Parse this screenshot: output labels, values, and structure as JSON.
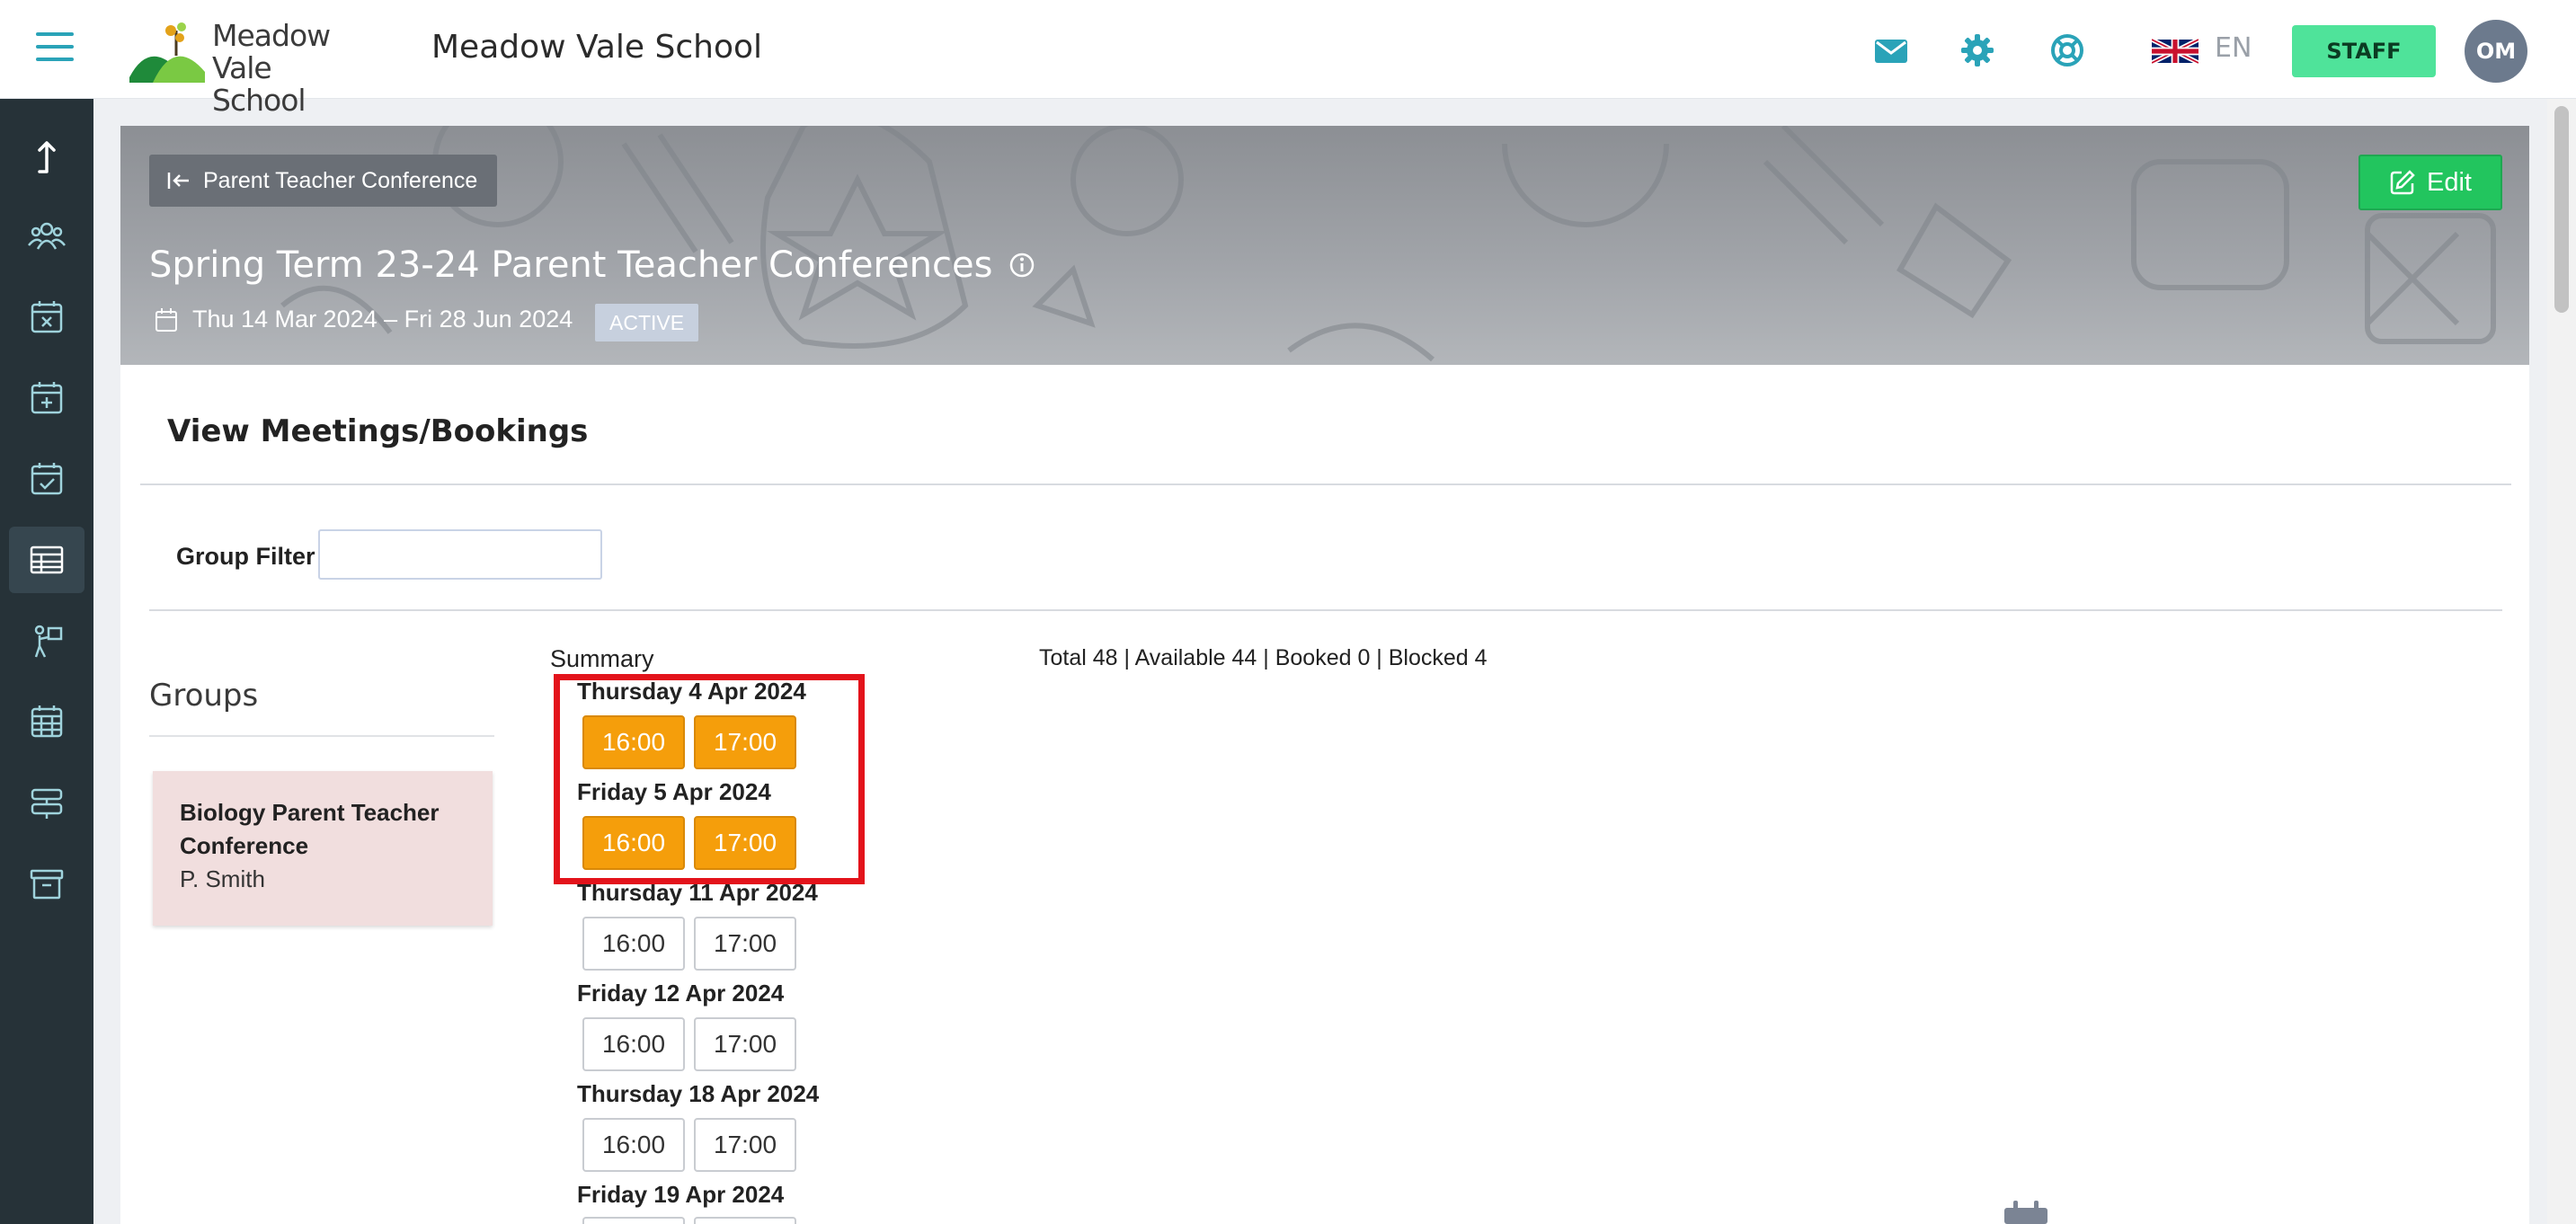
{
  "header": {
    "logo_line1": "Meadow",
    "logo_line2": "Vale School",
    "school_name": "Meadow Vale School",
    "language": "EN",
    "role_button": "STAFF",
    "avatar_initials": "OM"
  },
  "sidebar": {
    "items": [
      {
        "icon": "upload-icon"
      },
      {
        "icon": "users-icon"
      },
      {
        "icon": "calendar-x-icon"
      },
      {
        "icon": "calendar-plus-icon"
      },
      {
        "icon": "calendar-check-icon"
      },
      {
        "icon": "table-icon",
        "active": true
      },
      {
        "icon": "person-board-icon"
      },
      {
        "icon": "calendar-grid-icon"
      },
      {
        "icon": "signpost-icon"
      },
      {
        "icon": "archive-icon"
      }
    ]
  },
  "hero": {
    "back_label": "Parent Teacher Conference",
    "edit_label": "Edit",
    "title": "Spring Term 23-24 Parent Teacher Conferences",
    "date_range": "Thu 14 Mar 2024 – Fri 28 Jun 2024",
    "status": "ACTIVE"
  },
  "content": {
    "section_title": "View Meetings/Bookings",
    "filter_label": "Group Filter",
    "filter_value": ""
  },
  "groups": {
    "title": "Groups",
    "items": [
      {
        "name_line1": "Biology Parent Teacher",
        "name_line2": "Conference",
        "teacher": "P. Smith"
      }
    ]
  },
  "summary": {
    "label": "Summary",
    "stats": "Total 48 | Available 44 | Booked 0 | Blocked 4"
  },
  "days": [
    {
      "label": "Thursday 4 Apr 2024",
      "slots": [
        {
          "time": "16:00",
          "state": "blocked"
        },
        {
          "time": "17:00",
          "state": "blocked"
        }
      ]
    },
    {
      "label": "Friday 5 Apr 2024",
      "slots": [
        {
          "time": "16:00",
          "state": "blocked"
        },
        {
          "time": "17:00",
          "state": "blocked"
        }
      ]
    },
    {
      "label": "Thursday 11 Apr 2024",
      "slots": [
        {
          "time": "16:00",
          "state": "available"
        },
        {
          "time": "17:00",
          "state": "available"
        }
      ]
    },
    {
      "label": "Friday 12 Apr 2024",
      "slots": [
        {
          "time": "16:00",
          "state": "available"
        },
        {
          "time": "17:00",
          "state": "available"
        }
      ]
    },
    {
      "label": "Thursday 18 Apr 2024",
      "slots": [
        {
          "time": "16:00",
          "state": "available"
        },
        {
          "time": "17:00",
          "state": "available"
        }
      ]
    },
    {
      "label": "Friday 19 Apr 2024",
      "slots": [
        {
          "time": "16:00",
          "state": "available"
        },
        {
          "time": "17:00",
          "state": "available"
        }
      ]
    }
  ],
  "colors": {
    "accent": "#2aa3b8",
    "staff_green": "#4fe39a",
    "edit_green": "#22c55e",
    "blocked_orange": "#f59e0b",
    "highlight_red": "#e3131b",
    "sidebar_bg": "#263238"
  }
}
